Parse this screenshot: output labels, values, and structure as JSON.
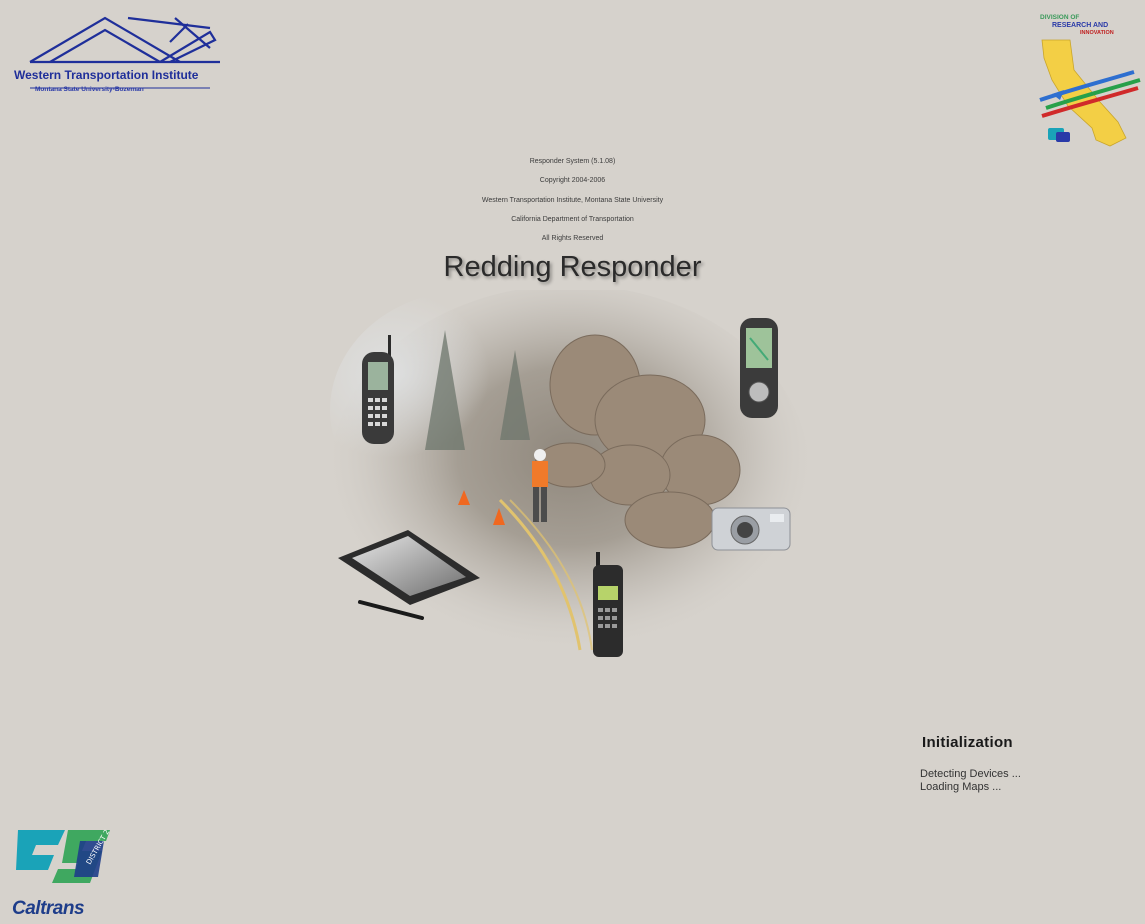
{
  "logos": {
    "wti": {
      "name": "Western Transportation Institute",
      "subtitle": "Montana State University-Bozeman"
    },
    "dri": {
      "line1": "DIVISION OF",
      "line2": "RESEARCH AND",
      "line3": "INNOVATION"
    },
    "caltrans": {
      "wordmark": "Caltrans",
      "district_label": "DISTRICT 2"
    }
  },
  "credits": {
    "lines": [
      "Responder System (5.1.08)",
      "Copyright 2004-2006",
      "Western Transportation Institute, Montana State University",
      "California Department of Transportation",
      "All Rights Reserved"
    ]
  },
  "app_title": "Redding Responder",
  "hero": {
    "devices": [
      "cell-phone",
      "gps-device",
      "tablet-pc",
      "digital-camera",
      "satellite-phone"
    ]
  },
  "initialization": {
    "heading": "Initialization",
    "status": [
      "Detecting Devices ...",
      "Loading Maps ..."
    ]
  },
  "colors": {
    "background": "#d6d2cc",
    "wti_blue": "#1f2f9a",
    "caltrans_teal": "#1aa3b8",
    "caltrans_green": "#3fa860"
  }
}
